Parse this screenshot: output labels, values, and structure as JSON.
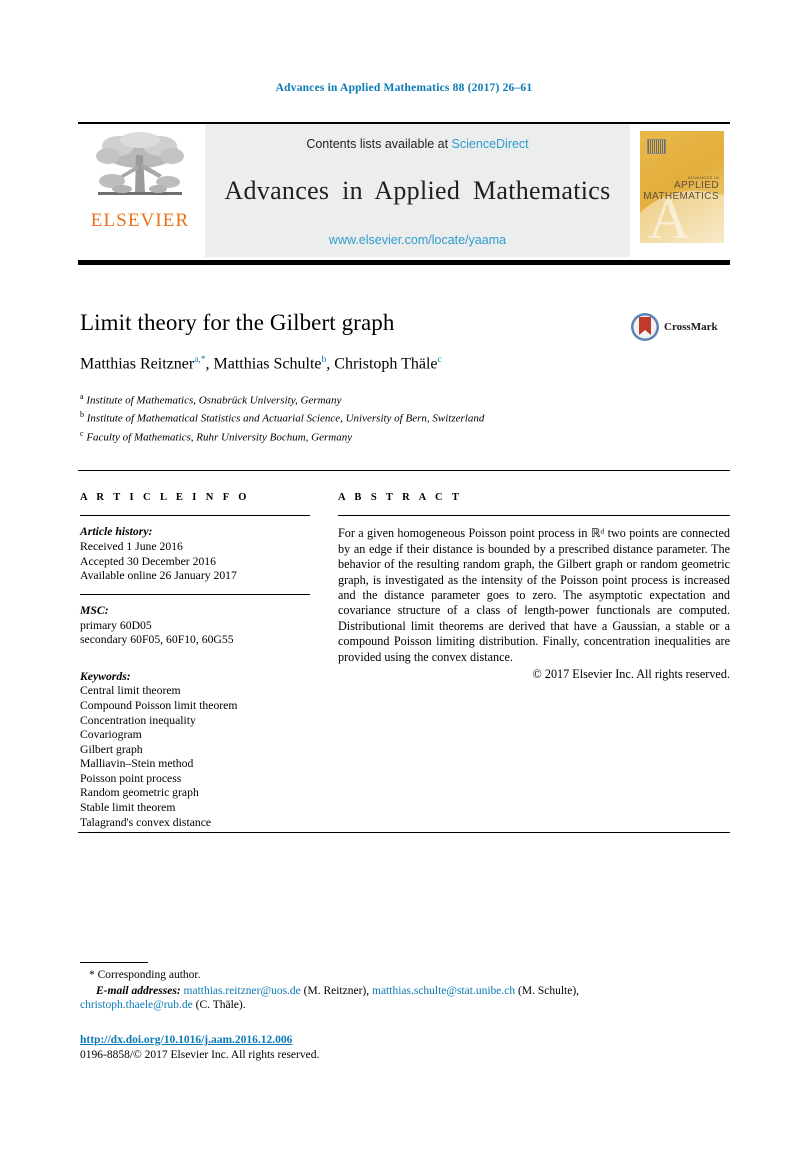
{
  "running_head": "Advances in Applied Mathematics 88 (2017) 26–61",
  "masthead": {
    "publisher_name": "ELSEVIER",
    "contents_prefix": "Contents lists available at ",
    "contents_link": "ScienceDirect",
    "journal_title": "Advances in Applied Mathematics",
    "journal_url": "www.elsevier.com/locate/yaama",
    "cover": {
      "line1": "ADVANCES IN",
      "line2": "APPLIED",
      "line3": "MATHEMATICS",
      "watermark": "A"
    }
  },
  "article": {
    "title": "Limit theory for the Gilbert graph",
    "authors": [
      {
        "name": "Matthias Reitzner",
        "marks": "a,*"
      },
      {
        "name": "Matthias Schulte",
        "marks": "b"
      },
      {
        "name": "Christoph Thäle",
        "marks": "c"
      }
    ],
    "crossmark_label": "CrossMark",
    "affiliations": [
      {
        "mark": "a",
        "text": "Institute of Mathematics, Osnabrück University, Germany"
      },
      {
        "mark": "b",
        "text": "Institute of Mathematical Statistics and Actuarial Science, University of Bern, Switzerland"
      },
      {
        "mark": "c",
        "text": "Faculty of Mathematics, Ruhr University Bochum, Germany"
      }
    ]
  },
  "article_info": {
    "heading": "A R T I C L E   I N F O",
    "history_label": "Article history:",
    "history": [
      "Received 1 June 2016",
      "Accepted 30 December 2016",
      "Available online 26 January 2017"
    ],
    "msc_label": "MSC:",
    "msc": [
      "primary 60D05",
      "secondary 60F05, 60F10, 60G55"
    ],
    "keywords_label": "Keywords:",
    "keywords": [
      "Central limit theorem",
      "Compound Poisson limit theorem",
      "Concentration inequality",
      "Covariogram",
      "Gilbert graph",
      "Malliavin–Stein method",
      "Poisson point process",
      "Random geometric graph",
      "Stable limit theorem",
      "Talagrand's convex distance"
    ]
  },
  "abstract": {
    "heading": "A B S T R A C T",
    "body": "For a given homogeneous Poisson point process in ℝᵈ two points are connected by an edge if their distance is bounded by a prescribed distance parameter. The behavior of the resulting random graph, the Gilbert graph or random geometric graph, is investigated as the intensity of the Poisson point process is increased and the distance parameter goes to zero. The asymptotic expectation and covariance structure of a class of length-power functionals are computed. Distributional limit theorems are derived that have a Gaussian, a stable or a compound Poisson limiting distribution. Finally, concentration inequalities are provided using the convex distance.",
    "copyright": "© 2017 Elsevier Inc. All rights reserved."
  },
  "footnotes": {
    "corresponding": "* Corresponding author.",
    "email_label": "E-mail addresses:",
    "emails": [
      {
        "address": "matthias.reitzner@uos.de",
        "person": "(M. Reitzner),"
      },
      {
        "address": "matthias.schulte@stat.unibe.ch",
        "person": "(M. Schulte),"
      },
      {
        "address": "christoph.thaele@rub.de",
        "person": "(C. Thäle)."
      }
    ]
  },
  "footer": {
    "doi": "http://dx.doi.org/10.1016/j.aam.2016.12.006",
    "issn_line": "0196-8858/© 2017 Elsevier Inc. All rights reserved."
  },
  "colors": {
    "link": "#0b7ab5",
    "masthead_link": "#2f9ccc",
    "elsevier_orange": "#E9711C",
    "masthead_bg": "#eceded"
  }
}
